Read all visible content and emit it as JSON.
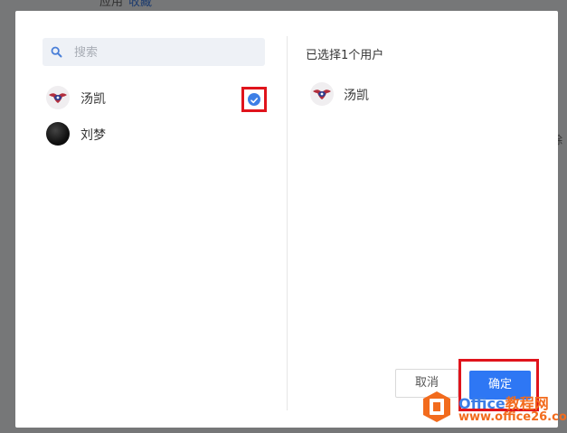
{
  "background": {
    "top_text": "应用",
    "top_link": "收藏",
    "right_text": "除"
  },
  "search": {
    "placeholder": "搜索"
  },
  "users": [
    {
      "name": "汤凯",
      "selected": true
    },
    {
      "name": "刘梦",
      "selected": false
    }
  ],
  "selection": {
    "title": "已选择1个用户",
    "users": [
      {
        "name": "汤凯"
      }
    ]
  },
  "buttons": {
    "cancel": "取消",
    "confirm": "确定"
  },
  "watermark": {
    "line1_a": "Office",
    "line1_b": "教程网",
    "line2": "www.office26.com"
  },
  "colors": {
    "primary": "#2e77f4",
    "highlight_border": "#e0141c",
    "watermark_orange": "#f26b1d"
  }
}
